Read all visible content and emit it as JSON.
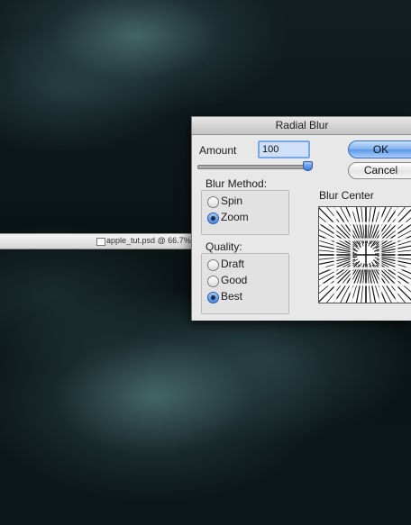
{
  "document": {
    "title": "apple_tut.psd @ 66.7%",
    "icon": "document-icon"
  },
  "dialog": {
    "title": "Radial Blur",
    "amount_label": "Amount",
    "amount_value": "100",
    "amount_slider_level": 100,
    "ok_label": "OK",
    "cancel_label": "Cancel",
    "blur_method": {
      "label": "Blur Method:",
      "options": [
        "Spin",
        "Zoom"
      ],
      "selected": "Zoom"
    },
    "quality": {
      "label": "Quality:",
      "options": [
        "Draft",
        "Good",
        "Best"
      ],
      "selected": "Best"
    },
    "blur_center_label": "Blur Center"
  },
  "colors": {
    "canvas_haze": "#6e9fa0",
    "focus_ring": "#78a7e6",
    "default_button": "#5a97e8"
  }
}
